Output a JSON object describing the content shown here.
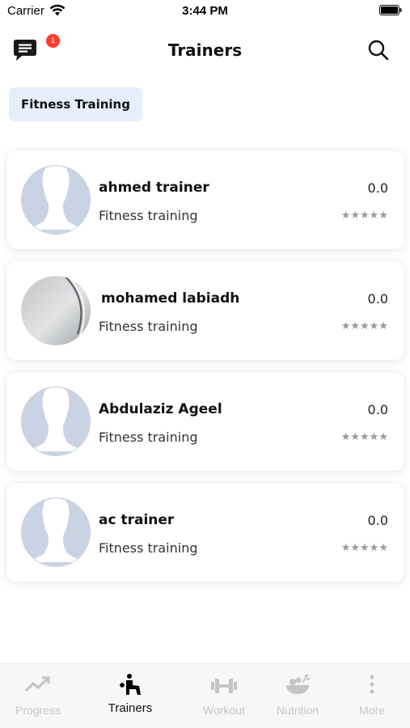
{
  "status_bar": {
    "carrier": "Carrier",
    "time": "3:44 PM"
  },
  "header": {
    "title": "Trainers",
    "chat_badge": "1"
  },
  "filter": {
    "label": "Fitness Training"
  },
  "trainers": [
    {
      "name": "ahmed trainer",
      "specialty": "Fitness training",
      "rating": "0.0",
      "stars": "★★★★★",
      "avatar": "placeholder-person"
    },
    {
      "name": "mohamed labiadh",
      "specialty": "Fitness training",
      "rating": "0.0",
      "stars": "★★★★★",
      "avatar": "photo"
    },
    {
      "name": "Abdulaziz Ageel",
      "specialty": "Fitness training",
      "rating": "0.0",
      "stars": "★★★★★",
      "avatar": "placeholder-person"
    },
    {
      "name": "ac trainer",
      "specialty": "Fitness training",
      "rating": "0.0",
      "stars": "★★★★★",
      "avatar": "placeholder-person"
    }
  ],
  "tabs": [
    {
      "label": "Progress",
      "icon": "trending-up-icon",
      "active": false
    },
    {
      "label": "Trainers",
      "icon": "trainer-icon",
      "active": true
    },
    {
      "label": "Workout",
      "icon": "dumbbell-icon",
      "active": false
    },
    {
      "label": "Nutrition",
      "icon": "salad-bowl-icon",
      "active": false
    },
    {
      "label": "More",
      "icon": "more-vertical-icon",
      "active": false
    }
  ],
  "colors": {
    "chip_bg": "#e6eefb",
    "avatar_placeholder": "#c9d3e3",
    "badge": "#ff3b30",
    "inactive_tab": "#c5c5c5"
  }
}
